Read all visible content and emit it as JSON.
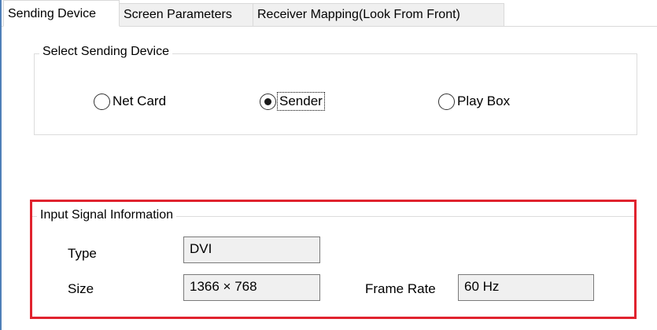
{
  "tabs": [
    {
      "label": "Sending Device"
    },
    {
      "label": "Screen Parameters"
    },
    {
      "label": "Receiver Mapping(Look From Front)"
    }
  ],
  "select_device": {
    "title": "Select Sending Device",
    "options": [
      {
        "label": "Net Card",
        "selected": false
      },
      {
        "label": "Sender",
        "selected": true
      },
      {
        "label": "Play Box",
        "selected": false
      }
    ]
  },
  "input_signal": {
    "title": "Input Signal Information",
    "type_label": "Type",
    "type_value": "DVI",
    "size_label": "Size",
    "size_value": "1366 × 768",
    "frame_rate_label": "Frame Rate",
    "frame_rate_value": "60 Hz"
  },
  "colors": {
    "highlight_outline": "#e0232e",
    "window_edge": "#4f7fb8"
  }
}
